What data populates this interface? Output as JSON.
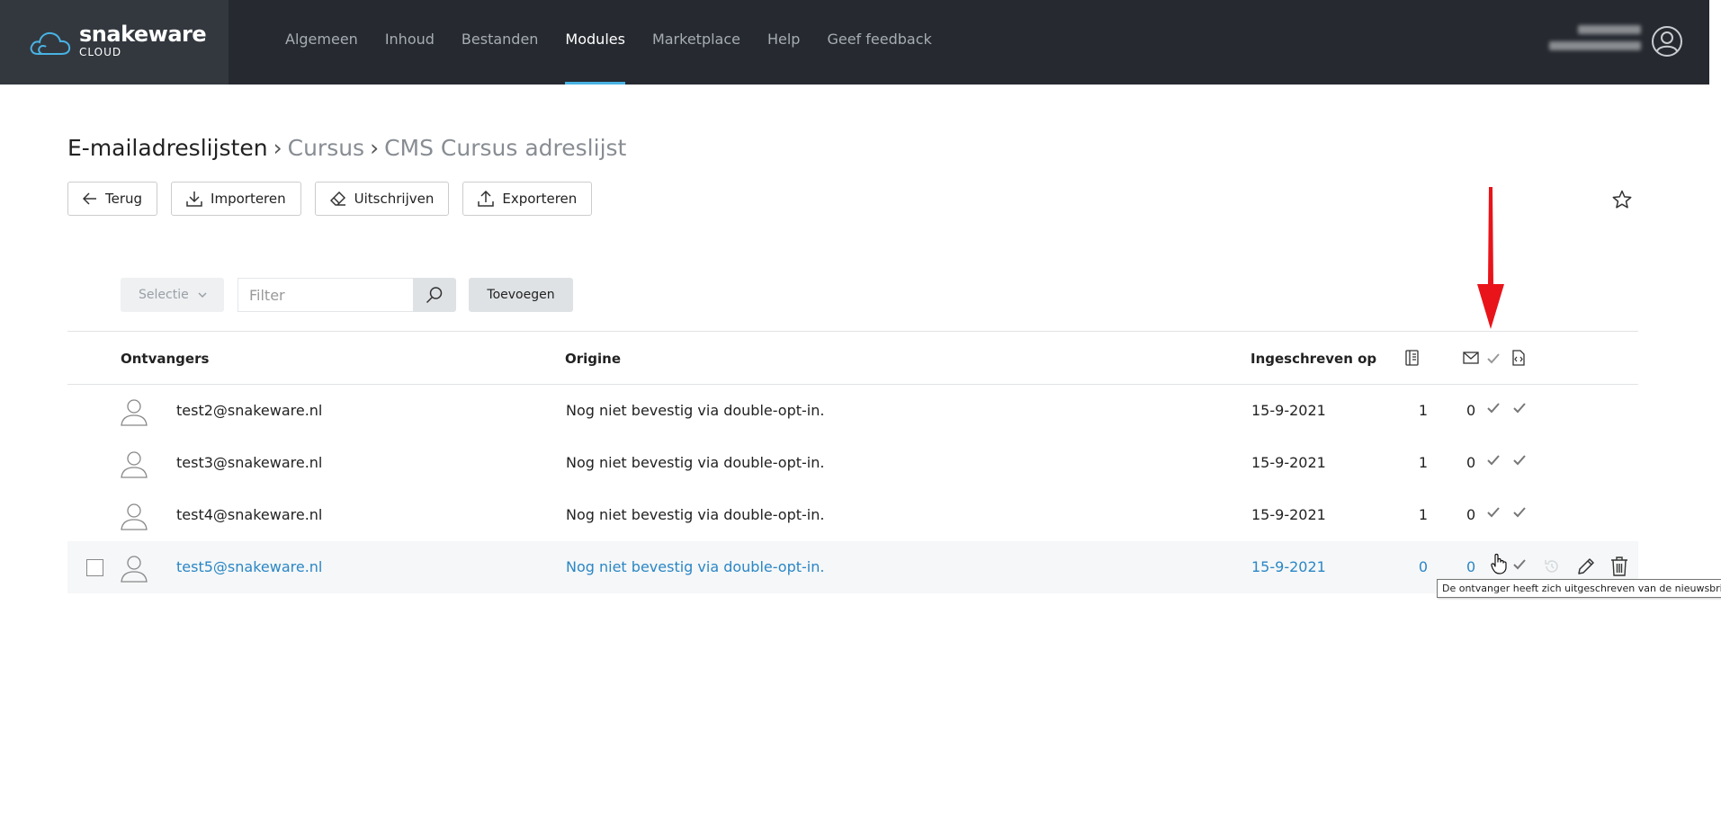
{
  "brand": {
    "name": "snakeware",
    "sub": "CLOUD"
  },
  "nav": {
    "items": [
      {
        "label": "Algemeen",
        "active": false
      },
      {
        "label": "Inhoud",
        "active": false
      },
      {
        "label": "Bestanden",
        "active": false
      },
      {
        "label": "Modules",
        "active": true
      },
      {
        "label": "Marketplace",
        "active": false
      },
      {
        "label": "Help",
        "active": false
      },
      {
        "label": "Geef feedback",
        "active": false
      }
    ]
  },
  "breadcrumb": {
    "root": "E-mailadreslijsten",
    "sep1": "›",
    "level1": "Cursus",
    "sep2": "›",
    "level2": "CMS Cursus adreslijst"
  },
  "toolbar": {
    "back": "Terug",
    "import": "Importeren",
    "unsubscribe": "Uitschrijven",
    "export": "Exporteren"
  },
  "filter": {
    "selection_label": "Selectie",
    "placeholder": "Filter",
    "add_label": "Toevoegen"
  },
  "table": {
    "headers": {
      "recipients": "Ontvangers",
      "origin": "Origine",
      "subscribed_on": "Ingeschreven op"
    },
    "rows": [
      {
        "email": "test2@snakeware.nl",
        "origin": "Nog niet bevestig via double-opt-in.",
        "date": "15-9-2021",
        "count": "1",
        "mail": "0"
      },
      {
        "email": "test3@snakeware.nl",
        "origin": "Nog niet bevestig via double-opt-in.",
        "date": "15-9-2021",
        "count": "1",
        "mail": "0"
      },
      {
        "email": "test4@snakeware.nl",
        "origin": "Nog niet bevestig via double-opt-in.",
        "date": "15-9-2021",
        "count": "1",
        "mail": "0"
      },
      {
        "email": "test5@snakeware.nl",
        "origin": "Nog niet bevestig via double-opt-in.",
        "date": "15-9-2021",
        "count": "0",
        "mail": "0"
      }
    ]
  },
  "tooltip": {
    "text": "De ontvanger heeft zich uitgeschreven van de nieuwsbrief."
  },
  "colors": {
    "topbar": "#262a30",
    "accent": "#49b3e3",
    "link": "#2b86c5",
    "annotation": "#e8141a"
  }
}
